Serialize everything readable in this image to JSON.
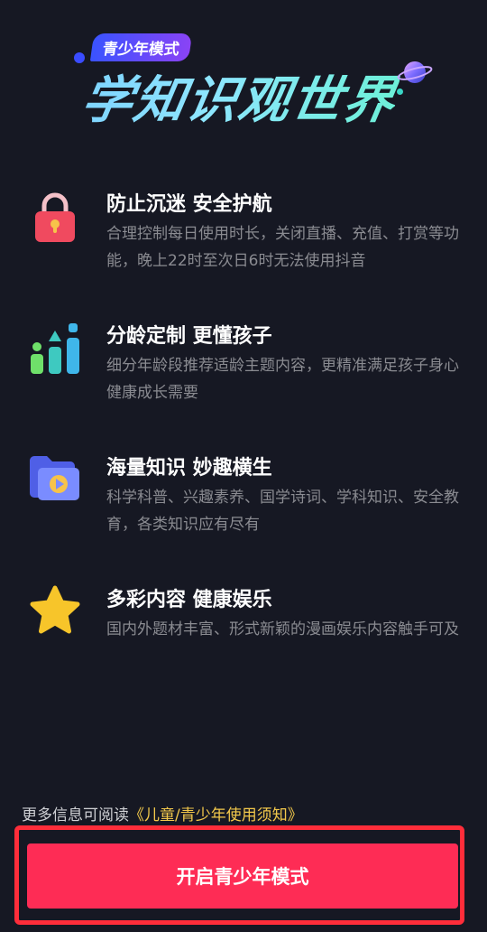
{
  "header": {
    "badge": "青少年模式",
    "title": "学知识观世界"
  },
  "features": [
    {
      "title": "防止沉迷 安全护航",
      "description": "合理控制每日使用时长，关闭直播、充值、打赏等功能，晚上22时至次日6时无法使用抖音",
      "icon": "lock-icon"
    },
    {
      "title": "分龄定制 更懂孩子",
      "description": "细分年龄段推荐适龄主题内容，更精准满足孩子身心健康成长需要",
      "icon": "bar-chart-icon"
    },
    {
      "title": "海量知识 妙趣横生",
      "description": "科学科普、兴趣素养、国学诗词、学科知识、安全教育，各类知识应有尽有",
      "icon": "video-folder-icon"
    },
    {
      "title": "多彩内容 健康娱乐",
      "description": "国内外题材丰富、形式新颖的漫画娱乐内容触手可及",
      "icon": "star-icon"
    }
  ],
  "footer": {
    "note_prefix": "更多信息可阅读",
    "link_label": "《儿童/青少年使用须知》"
  },
  "cta": {
    "label": "开启青少年模式"
  },
  "colors": {
    "background": "#161823",
    "primary": "#fe2c55",
    "link": "#f2c84b",
    "description": "#8a8b91"
  }
}
